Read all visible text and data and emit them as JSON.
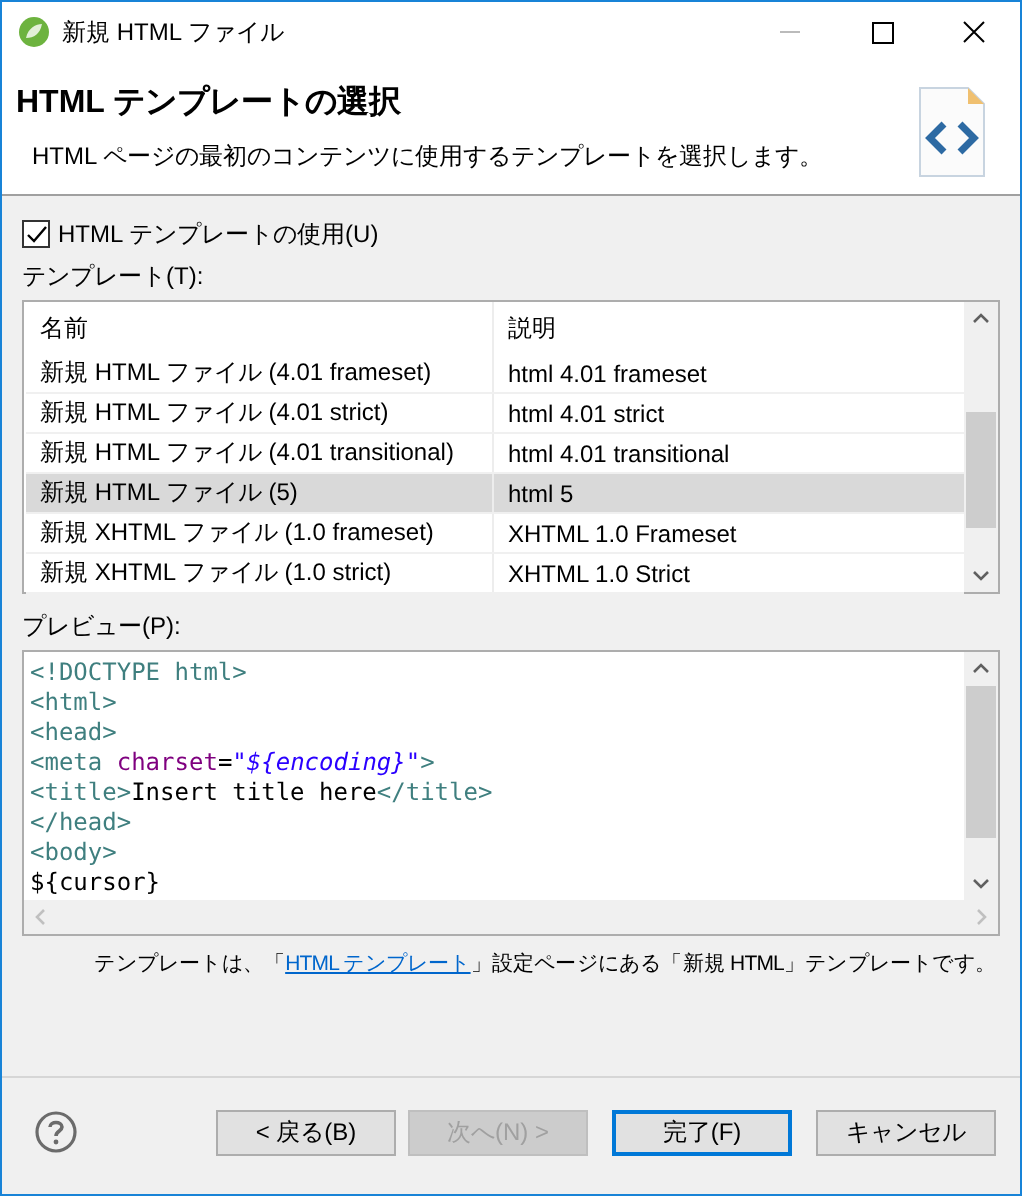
{
  "window": {
    "title": "新規 HTML ファイル"
  },
  "header": {
    "title": "HTML テンプレートの選択",
    "description": "HTML ページの最初のコンテンツに使用するテンプレートを選択します。"
  },
  "use_template": {
    "label": "HTML テンプレートの使用(U)",
    "checked": true
  },
  "templates_label": "テンプレート(T):",
  "table": {
    "columns": [
      "名前",
      "説明"
    ],
    "rows": [
      {
        "name": "新規 HTML ファイル (4.01 frameset)",
        "description": "html 4.01 frameset",
        "selected": false
      },
      {
        "name": "新規 HTML ファイル (4.01 strict)",
        "description": "html 4.01 strict",
        "selected": false
      },
      {
        "name": "新規 HTML ファイル (4.01 transitional)",
        "description": "html 4.01 transitional",
        "selected": false
      },
      {
        "name": "新規 HTML ファイル (5)",
        "description": "html 5",
        "selected": true
      },
      {
        "name": "新規 XHTML ファイル (1.0 frameset)",
        "description": "XHTML 1.0 Frameset",
        "selected": false
      },
      {
        "name": "新規 XHTML ファイル (1.0 strict)",
        "description": "XHTML 1.0 Strict",
        "selected": false
      }
    ]
  },
  "preview_label": "プレビュー(P):",
  "preview": {
    "lines": [
      [
        {
          "kind": "tag",
          "text": "<!DOCTYPE html>"
        }
      ],
      [
        {
          "kind": "tag",
          "text": "<html>"
        }
      ],
      [
        {
          "kind": "tag",
          "text": "<head>"
        }
      ],
      [
        {
          "kind": "tag",
          "text": "<meta "
        },
        {
          "kind": "attr",
          "text": "charset"
        },
        {
          "kind": "plain",
          "text": "="
        },
        {
          "kind": "string",
          "text": "\"${encoding}\""
        },
        {
          "kind": "tag",
          "text": ">"
        }
      ],
      [
        {
          "kind": "tag",
          "text": "<title>"
        },
        {
          "kind": "plain",
          "text": "Insert title here"
        },
        {
          "kind": "tag",
          "text": "</title>"
        }
      ],
      [
        {
          "kind": "tag",
          "text": "</head>"
        }
      ],
      [
        {
          "kind": "tag",
          "text": "<body>"
        }
      ],
      [
        {
          "kind": "plain",
          "text": "${cursor}"
        }
      ]
    ]
  },
  "note": {
    "before": "テンプレートは、「",
    "link": "HTML テンプレート",
    "after": "」設定ページにある「新規 HTML」テンプレートです。"
  },
  "buttons": [
    {
      "label": "< 戻る(B)",
      "disabled": false,
      "default": false
    },
    {
      "label": "次へ(N) >",
      "disabled": true,
      "default": false
    },
    {
      "label": "完了(F)",
      "disabled": false,
      "default": true
    },
    {
      "label": "キャンセル",
      "disabled": false,
      "default": false
    }
  ]
}
